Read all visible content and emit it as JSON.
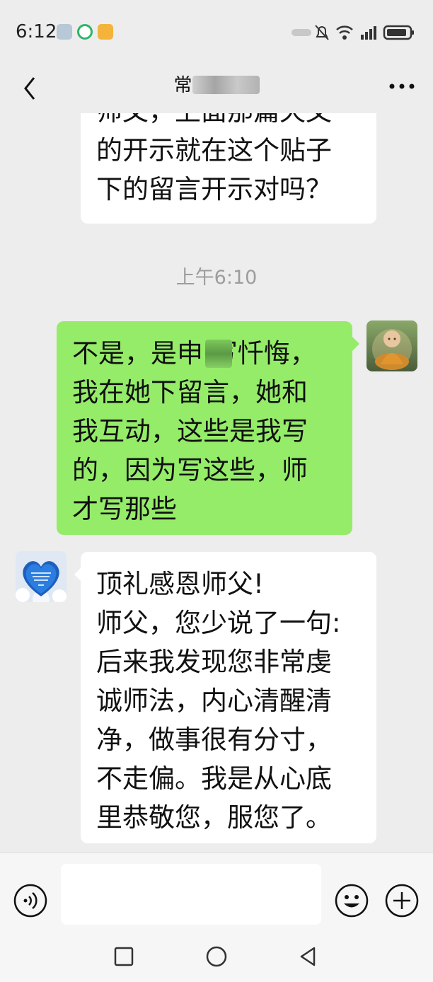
{
  "status_bar": {
    "time": "6:12"
  },
  "header": {
    "title": "常"
  },
  "messages": [
    {
      "side": "left",
      "text": "师父，上面那篇天文\n的开示就在这个贴子\n下的留言开示对吗？"
    },
    {
      "side": "right",
      "text": "不是，是申 写忏悔，\n我在她下留言，她和\n我互动，这些是我写\n的，因为写这些，师\n才写那些"
    },
    {
      "side": "left",
      "text": "顶礼感恩师父!\n师父，您少说了一句:\n后来我发现您非常虔\n诚师法，内心清醒清\n净，做事很有分寸，\n不走偏。我是从心底\n里恭敬您，服您了。"
    }
  ],
  "timestamp": "上午6:10",
  "colors": {
    "background": "#ededed",
    "bubble_self": "#95ec69",
    "bubble_other": "#ffffff",
    "timestamp": "#9d9d9d"
  }
}
